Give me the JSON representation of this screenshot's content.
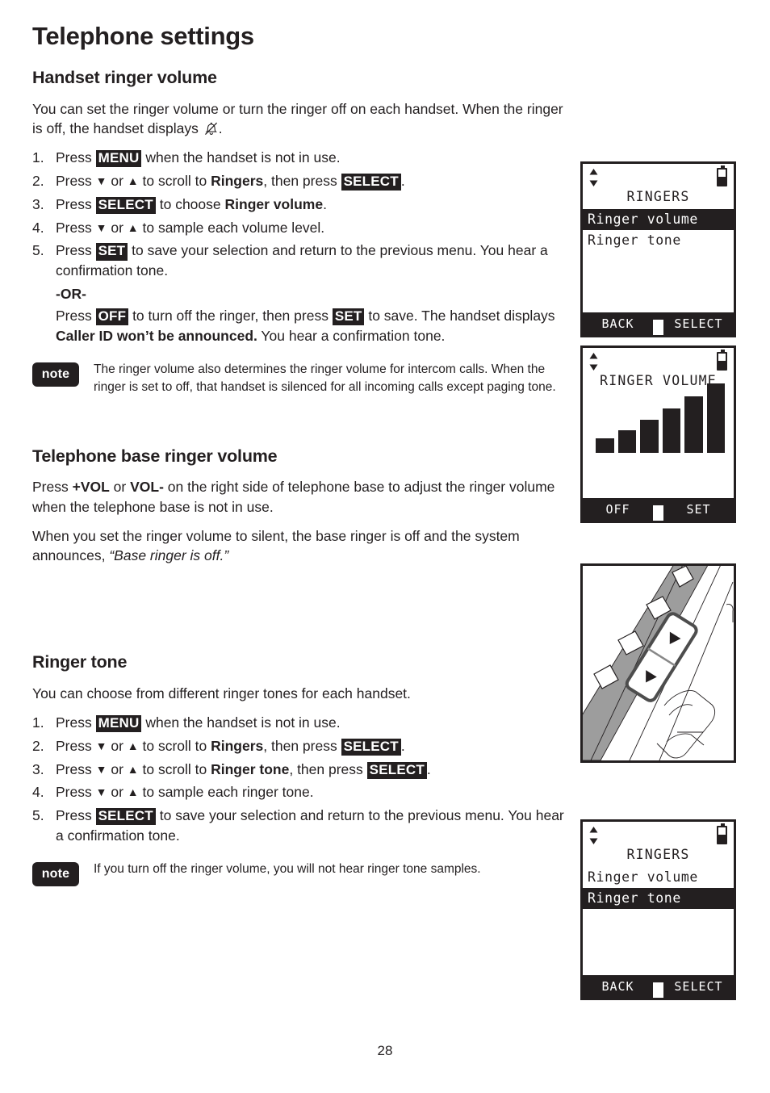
{
  "page": {
    "title": "Telephone settings",
    "number": "28"
  },
  "handset_ringer_volume": {
    "heading": "Handset ringer volume",
    "intro_a": "You can set the ringer volume or turn the ringer off on each handset. When the ringer is off, the handset displays ",
    "intro_b": ".",
    "bell_off_icon": "bell-off-icon",
    "steps": [
      {
        "num": "1.",
        "parts": [
          {
            "t": "text",
            "v": "Press "
          },
          {
            "t": "key",
            "v": "MENU"
          },
          {
            "t": "text",
            "v": " when the handset is not in use."
          }
        ]
      },
      {
        "num": "2.",
        "parts": [
          {
            "t": "text",
            "v": "Press "
          },
          {
            "t": "glyph",
            "v": "▼"
          },
          {
            "t": "text",
            "v": " or "
          },
          {
            "t": "glyph",
            "v": "▲"
          },
          {
            "t": "text",
            "v": " to scroll to "
          },
          {
            "t": "bold",
            "v": "Ringers"
          },
          {
            "t": "text",
            "v": ", then press "
          },
          {
            "t": "key",
            "v": "SELECT"
          },
          {
            "t": "text",
            "v": "."
          }
        ]
      },
      {
        "num": "3.",
        "parts": [
          {
            "t": "text",
            "v": "Press "
          },
          {
            "t": "key",
            "v": "SELECT"
          },
          {
            "t": "text",
            "v": " to choose "
          },
          {
            "t": "bold",
            "v": "Ringer volume"
          },
          {
            "t": "text",
            "v": "."
          }
        ]
      },
      {
        "num": "4.",
        "parts": [
          {
            "t": "text",
            "v": "Press "
          },
          {
            "t": "glyph",
            "v": "▼"
          },
          {
            "t": "text",
            "v": " or "
          },
          {
            "t": "glyph",
            "v": "▲"
          },
          {
            "t": "text",
            "v": " to sample each volume level."
          }
        ]
      },
      {
        "num": "5.",
        "parts": [
          {
            "t": "text",
            "v": "Press "
          },
          {
            "t": "key",
            "v": "SET"
          },
          {
            "t": "text",
            "v": " to save your selection and return to the previous menu. You hear a confirmation tone."
          }
        ]
      }
    ],
    "or_label": "-OR-",
    "or_parts": [
      {
        "t": "text",
        "v": "Press "
      },
      {
        "t": "key",
        "v": "OFF"
      },
      {
        "t": "text",
        "v": " to turn off the ringer, then press "
      },
      {
        "t": "key",
        "v": "SET"
      },
      {
        "t": "text",
        "v": " to save. The handset displays "
      },
      {
        "t": "bold",
        "v": "Caller ID won’t be announced."
      },
      {
        "t": "text",
        "v": " You hear a confirmation tone."
      }
    ],
    "note": {
      "badge": "note",
      "text": "The ringer volume also determines the ringer volume for intercom calls. When the ringer is set to off, that handset is silenced for all incoming calls except paging tone."
    }
  },
  "base_ringer_volume": {
    "heading": "Telephone base ringer volume",
    "para1_parts": [
      {
        "t": "text",
        "v": "Press "
      },
      {
        "t": "bold",
        "v": "+VOL"
      },
      {
        "t": "text",
        "v": " or "
      },
      {
        "t": "bold",
        "v": "VOL-"
      },
      {
        "t": "text",
        "v": " on the right side of telephone base to adjust the ringer volume when the telephone base is not in use."
      }
    ],
    "para2_parts": [
      {
        "t": "text",
        "v": "When you set the ringer volume to silent, the base ringer is off and the system announces, "
      },
      {
        "t": "italic",
        "v": "“Base ringer is off.”"
      }
    ]
  },
  "ringer_tone": {
    "heading": "Ringer tone",
    "intro": "You can choose from different ringer tones for each handset.",
    "steps": [
      {
        "num": "1.",
        "parts": [
          {
            "t": "text",
            "v": "Press "
          },
          {
            "t": "key",
            "v": "MENU"
          },
          {
            "t": "text",
            "v": " when the handset is not in use."
          }
        ]
      },
      {
        "num": "2.",
        "parts": [
          {
            "t": "text",
            "v": "Press "
          },
          {
            "t": "glyph",
            "v": "▼"
          },
          {
            "t": "text",
            "v": " or "
          },
          {
            "t": "glyph",
            "v": "▲"
          },
          {
            "t": "text",
            "v": " to scroll to "
          },
          {
            "t": "bold",
            "v": "Ringers"
          },
          {
            "t": "text",
            "v": ", then press "
          },
          {
            "t": "key",
            "v": "SELECT"
          },
          {
            "t": "text",
            "v": "."
          }
        ]
      },
      {
        "num": "3.",
        "parts": [
          {
            "t": "text",
            "v": "Press "
          },
          {
            "t": "glyph",
            "v": "▼"
          },
          {
            "t": "text",
            "v": " or "
          },
          {
            "t": "glyph",
            "v": "▲"
          },
          {
            "t": "text",
            "v": " to scroll to "
          },
          {
            "t": "bold",
            "v": "Ringer tone"
          },
          {
            "t": "text",
            "v": ", then press "
          },
          {
            "t": "key",
            "v": "SELECT"
          },
          {
            "t": "text",
            "v": "."
          }
        ]
      },
      {
        "num": "4.",
        "parts": [
          {
            "t": "text",
            "v": "Press "
          },
          {
            "t": "glyph",
            "v": "▼"
          },
          {
            "t": "text",
            "v": " or "
          },
          {
            "t": "glyph",
            "v": "▲"
          },
          {
            "t": "text",
            "v": " to sample each ringer tone."
          }
        ]
      },
      {
        "num": "5.",
        "parts": [
          {
            "t": "text",
            "v": "Press "
          },
          {
            "t": "key",
            "v": "SELECT"
          },
          {
            "t": "text",
            "v": " to save your selection and return to the previous menu. You hear a confirmation tone."
          }
        ]
      }
    ],
    "note": {
      "badge": "note",
      "text": "If you turn off the ringer volume, you will not hear ringer tone samples."
    }
  },
  "screens": [
    {
      "id": "ringers-menu-volume-selected",
      "title": "RINGERS",
      "items": [
        {
          "label": "Ringer volume",
          "selected": true
        },
        {
          "label": "Ringer tone",
          "selected": false
        }
      ],
      "softkeys": {
        "left": "BACK",
        "right": "SELECT"
      },
      "status": {
        "scroll_icon": "scroll-up-down-icon",
        "battery_icon": "battery-icon",
        "battery_level": 52
      }
    },
    {
      "id": "ringer-volume-levels",
      "title": "RINGER VOLUME",
      "softkeys": {
        "left": "OFF",
        "right": "SET"
      },
      "status": {
        "scroll_icon": "scroll-up-down-icon",
        "battery_icon": "battery-icon",
        "battery_level": 52
      },
      "volume_bars": [
        18,
        28,
        41,
        55,
        70,
        86
      ]
    },
    {
      "id": "ringers-menu-tone-selected",
      "title": "RINGERS",
      "items": [
        {
          "label": "Ringer volume",
          "selected": false
        },
        {
          "label": "Ringer tone",
          "selected": true
        }
      ],
      "softkeys": {
        "left": "BACK",
        "right": "SELECT"
      },
      "status": {
        "scroll_icon": "scroll-up-down-icon",
        "battery_icon": "battery-icon",
        "battery_level": 52
      }
    }
  ],
  "base_illustration": {
    "name": "telephone-base-side-volume-buttons",
    "caption": ""
  },
  "colors": {
    "ink": "#231f20",
    "paper": "#ffffff",
    "panel_gray": "#9d9d9d"
  }
}
